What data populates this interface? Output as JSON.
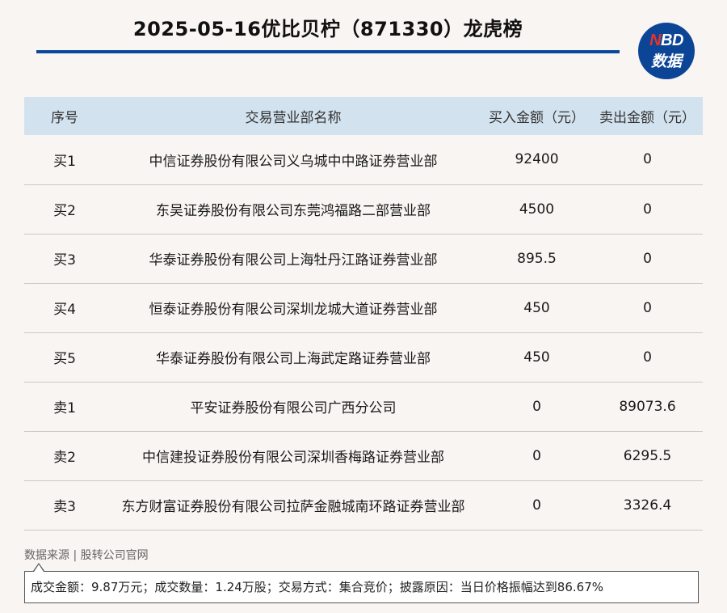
{
  "title": "2025-05-16优比贝柠（871330）龙虎榜",
  "logo": {
    "line1_n": "N",
    "line1_rest": "BD",
    "line2": "数据"
  },
  "table": {
    "headers": [
      "序号",
      "交易营业部名称",
      "买入金额（元）",
      "卖出金额（元）"
    ],
    "rows": [
      [
        "买1",
        "中信证券股份有限公司义乌城中中路证券营业部",
        "92400",
        "0"
      ],
      [
        "买2",
        "东吴证券股份有限公司东莞鸿福路二部营业部",
        "4500",
        "0"
      ],
      [
        "买3",
        "华泰证券股份有限公司上海牡丹江路证券营业部",
        "895.5",
        "0"
      ],
      [
        "买4",
        "恒泰证券股份有限公司深圳龙城大道证券营业部",
        "450",
        "0"
      ],
      [
        "买5",
        "华泰证券股份有限公司上海武定路证券营业部",
        "450",
        "0"
      ],
      [
        "卖1",
        "平安证券股份有限公司广西分公司",
        "0",
        "89073.6"
      ],
      [
        "卖2",
        "中信建投证券股份有限公司深圳香梅路证券营业部",
        "0",
        "6295.5"
      ],
      [
        "卖3",
        "东方财富证券股份有限公司拉萨金融城南环路证券营业部",
        "0",
        "3326.4"
      ]
    ]
  },
  "source": "数据来源 | 股转公司官网",
  "note": "成交金额：9.87万元；成交数量：1.24万股；交易方式：集合竞价；披露原因：当日价格振幅达到86.67%",
  "colors": {
    "accent": "#0a4a9a",
    "header_bg": "#d3e2ef",
    "logo_bg": "#0d4596",
    "logo_n": "#e5322d",
    "page_bg": "#f8f5f2"
  }
}
